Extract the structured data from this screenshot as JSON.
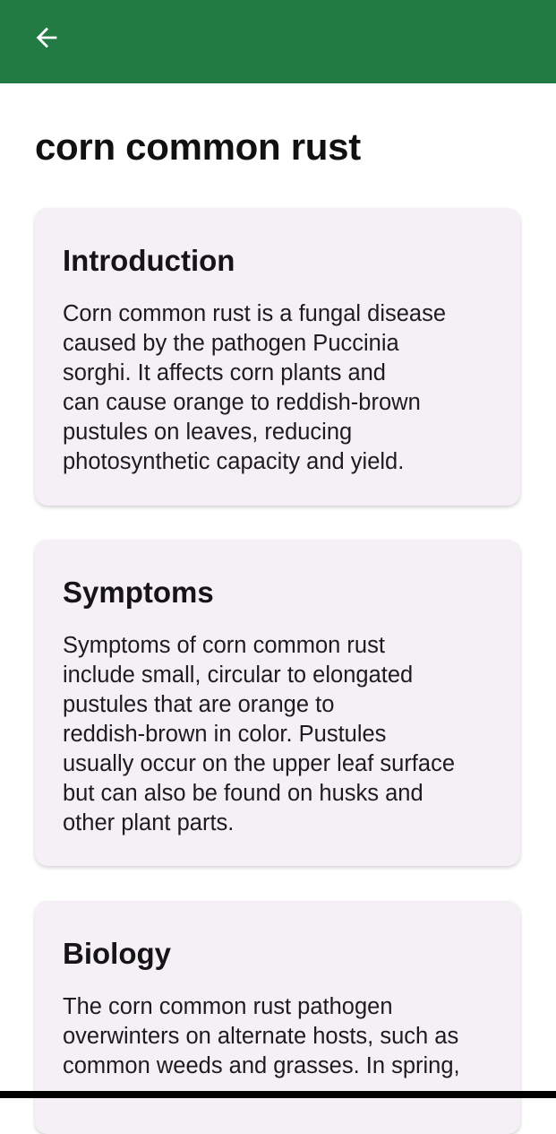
{
  "header": {
    "back_icon": "arrow-left-icon",
    "background_color": "#217b43"
  },
  "page": {
    "title": "corn common rust"
  },
  "sections": [
    {
      "title": "Introduction",
      "body": "Corn common rust is a fungal disease\ncaused by the pathogen Puccinia\nsorghi. It affects corn plants and\ncan cause orange to reddish-brown\npustules on leaves, reducing\nphotosynthetic capacity and yield."
    },
    {
      "title": "Symptoms",
      "body": "Symptoms of corn common rust\ninclude small, circular to elongated\npustules that are orange to\nreddish-brown in color. Pustules\nusually occur on the upper leaf surface\nbut can also be found on husks and\nother plant parts."
    },
    {
      "title": "Biology",
      "body": "The corn common rust pathogen\noverwinters on alternate hosts, such as\ncommon weeds and grasses. In spring,"
    }
  ]
}
